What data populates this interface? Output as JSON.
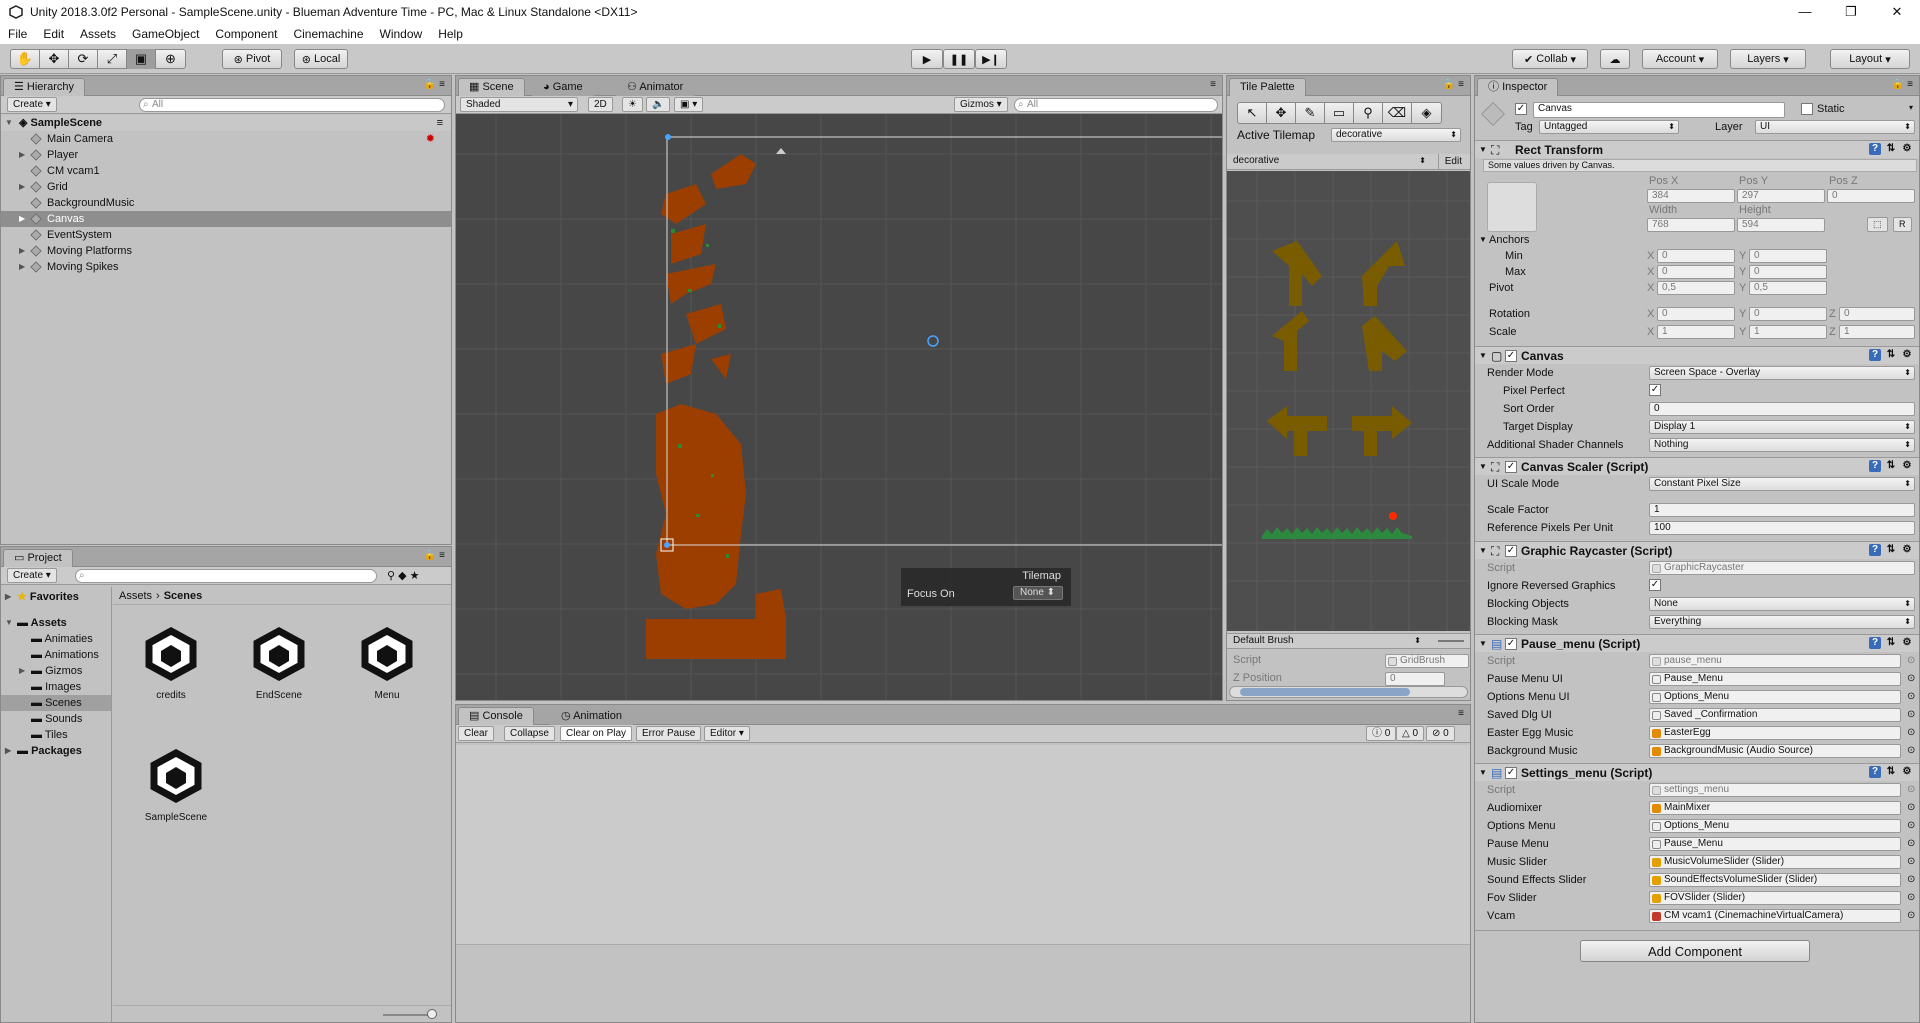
{
  "window": {
    "title": "Unity 2018.3.0f2 Personal - SampleScene.unity - Blueman Adventure Time - PC, Mac & Linux Standalone <DX11>"
  },
  "menu": [
    "File",
    "Edit",
    "Assets",
    "GameObject",
    "Component",
    "Cinemachine",
    "Window",
    "Help"
  ],
  "toolbar": {
    "pivot": "Pivot",
    "local": "Local",
    "collab": "Collab",
    "account": "Account",
    "layers": "Layers",
    "layout": "Layout"
  },
  "hierarchy": {
    "tab": "Hierarchy",
    "create": "Create",
    "search_placeholder": "All",
    "scene": "SampleScene",
    "items": [
      "Main Camera",
      "Player",
      "CM vcam1",
      "Grid",
      "BackgroundMusic",
      "Canvas",
      "EventSystem",
      "Moving Platforms",
      "Moving Spikes"
    ]
  },
  "scene_view": {
    "tabs": [
      "Scene",
      "Game",
      "Animator"
    ],
    "shading": "Shaded",
    "mode2d": "2D",
    "gizmos": "Gizmos",
    "search_placeholder": "All",
    "overlay_title": "Tilemap",
    "overlay_focus_label": "Focus On",
    "overlay_focus_value": "None"
  },
  "tile_palette": {
    "tab": "Tile Palette",
    "active_tilemap_label": "Active Tilemap",
    "active_tilemap": "decorative",
    "palette": "decorative",
    "edit": "Edit",
    "brush": "Default Brush",
    "script_label": "Script",
    "script_value": "GridBrush",
    "zpos_label": "Z Position",
    "zpos_value": "0"
  },
  "project": {
    "tab": "Project",
    "create": "Create",
    "favorites": "Favorites",
    "assets": "Assets",
    "folders": [
      "Animaties",
      "Animations",
      "Gizmos",
      "Images",
      "Scenes",
      "Sounds",
      "Tiles"
    ],
    "packages": "Packages",
    "breadcrumb": [
      "Assets",
      "Scenes"
    ],
    "files": [
      "credits",
      "EndScene",
      "Menu",
      "SampleScene"
    ]
  },
  "console": {
    "tabs": [
      "Console",
      "Animation"
    ],
    "buttons": [
      "Clear",
      "Collapse",
      "Clear on Play",
      "Error Pause",
      "Editor"
    ],
    "counts": [
      "0",
      "0",
      "0"
    ]
  },
  "inspector": {
    "tab": "Inspector",
    "object_name": "Canvas",
    "static": "Static",
    "tag_label": "Tag",
    "tag": "Untagged",
    "layer_label": "Layer",
    "layer": "UI",
    "rect": {
      "title": "Rect Transform",
      "note": "Some values driven by Canvas.",
      "pos_x_label": "Pos X",
      "pos_y_label": "Pos Y",
      "pos_z_label": "Pos Z",
      "pos_x": "384",
      "pos_y": "297",
      "pos_z": "0",
      "width_label": "Width",
      "height_label": "Height",
      "width": "768",
      "height": "594",
      "anchors": "Anchors",
      "min": "Min",
      "max": "Max",
      "pivot": "Pivot",
      "rotation": "Rotation",
      "scale": "Scale",
      "min_x": "0",
      "min_y": "0",
      "max_x": "0",
      "max_y": "0",
      "pivot_x": "0,5",
      "pivot_y": "0,5",
      "rot_x": "0",
      "rot_y": "0",
      "rot_z": "0",
      "sc_x": "1",
      "sc_y": "1",
      "sc_z": "1",
      "r": "R"
    },
    "canvas": {
      "title": "Canvas",
      "render_mode_label": "Render Mode",
      "render_mode": "Screen Space - Overlay",
      "pixel_perfect": "Pixel Perfect",
      "sort_order_label": "Sort Order",
      "sort_order": "0",
      "target_display_label": "Target Display",
      "target_display": "Display 1",
      "shader_channels_label": "Additional Shader Channels",
      "shader_channels": "Nothing"
    },
    "scaler": {
      "title": "Canvas Scaler (Script)",
      "mode_label": "UI Scale Mode",
      "mode": "Constant Pixel Size",
      "scale_factor_label": "Scale Factor",
      "scale_factor": "1",
      "ref_label": "Reference Pixels Per Unit",
      "ref": "100"
    },
    "raycaster": {
      "title": "Graphic Raycaster (Script)",
      "script_label": "Script",
      "script": "GraphicRaycaster",
      "ignore_label": "Ignore Reversed Graphics",
      "blocking_label": "Blocking Objects",
      "blocking": "None",
      "mask_label": "Blocking Mask",
      "mask": "Everything"
    },
    "pause": {
      "title": "Pause_menu (Script)",
      "script_label": "Script",
      "script": "pause_menu",
      "fields": [
        {
          "label": "Pause Menu UI",
          "value": "Pause_Menu"
        },
        {
          "label": "Options Menu UI",
          "value": "Options_Menu"
        },
        {
          "label": "Saved Dlg UI",
          "value": "Saved _Confirmation"
        },
        {
          "label": "Easter Egg Music",
          "value": "EasterEgg"
        },
        {
          "label": "Background Music",
          "value": "BackgroundMusic (Audio Source)"
        }
      ]
    },
    "settings": {
      "title": "Settings_menu (Script)",
      "script_label": "Script",
      "script": "settings_menu",
      "fields": [
        {
          "label": "Audiomixer",
          "value": "MainMixer"
        },
        {
          "label": "Options Menu",
          "value": "Options_Menu"
        },
        {
          "label": "Pause Menu",
          "value": "Pause_Menu"
        },
        {
          "label": "Music Slider",
          "value": "MusicVolumeSlider (Slider)"
        },
        {
          "label": "Sound Effects Slider",
          "value": "SoundEffectsVolumeSlider (Slider)"
        },
        {
          "label": "Fov Slider",
          "value": "FOVSlider (Slider)"
        },
        {
          "label": "Vcam",
          "value": "CM vcam1 (CinemachineVirtualCamera)"
        }
      ]
    },
    "add_component": "Add Component"
  },
  "colors": {
    "scene_bg": "#474747",
    "tile_bg": "#4e4e4e",
    "tile_rust": "#9b3e00",
    "arrow": "#7a5c00"
  }
}
